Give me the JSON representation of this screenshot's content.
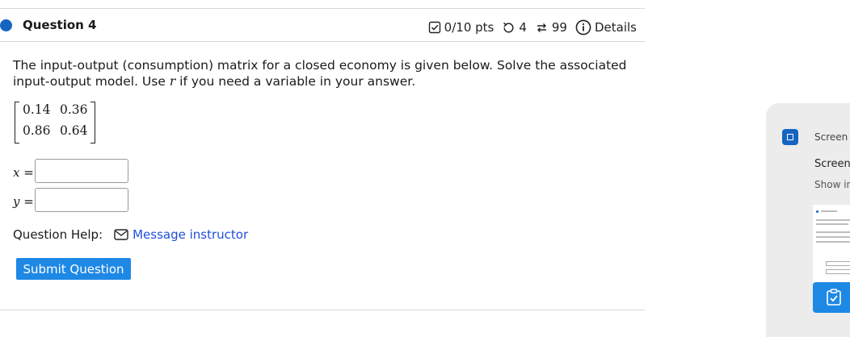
{
  "question": {
    "title": "Question 4",
    "points": "0/10 pts",
    "retries": "4",
    "attempts": "99",
    "details_label": "Details",
    "text_before_var": "The input-output (consumption) matrix for a closed economy is given below. Solve the associated input-output model. Use ",
    "variable": "r",
    "text_after_var": " if you need a variable in your answer.",
    "matrix": [
      [
        "0.14",
        "0.36"
      ],
      [
        "0.86",
        "0.64"
      ]
    ]
  },
  "answers": {
    "x_label": "x",
    "y_label": "y",
    "equals": "=",
    "x_value": "",
    "y_value": ""
  },
  "help": {
    "label": "Question Help:",
    "message_link": "Message instructor"
  },
  "submit_label": "Submit Question",
  "side_panel": {
    "top_label": "Screen",
    "title": "Screen",
    "subtitle": "Show in"
  },
  "colors": {
    "accent": "#1e88e5",
    "link": "#1f4fd8",
    "dot": "#1565c0"
  }
}
